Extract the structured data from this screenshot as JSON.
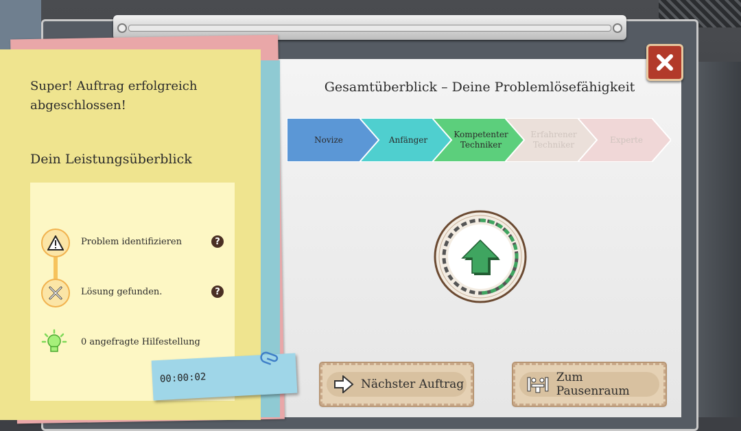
{
  "colors": {
    "novice": "#5b97d6",
    "beginner": "#4fcfcf",
    "competent": "#5ccf7c",
    "faded": "#ebe0da",
    "medal_arrow": "#3fa560",
    "close_button": "#b23a2a"
  },
  "left_panel": {
    "message": "Super! Auftrag erfolgreich abgeschlossen!",
    "performance_title": "Dein Leistungsüberblick",
    "rows": [
      {
        "icon": "warning-icon",
        "label": "Problem identifizieren",
        "help": "?"
      },
      {
        "icon": "tools-icon",
        "label": "Lösung gefunden.",
        "help": "?"
      },
      {
        "icon": "lightbulb-icon",
        "label": "0 angefragte Hilfestellung"
      }
    ],
    "timer": "00:00:02"
  },
  "main": {
    "title": "Gesamtüberblick – Deine Problemlösefähigkeit",
    "levels": [
      {
        "label": "Novize",
        "state": "active"
      },
      {
        "label": "Anfänger",
        "state": "active"
      },
      {
        "label": "Kompetenter Techniker",
        "state": "active"
      },
      {
        "label": "Erfahrener Techniker",
        "state": "inactive"
      },
      {
        "label": "Experte",
        "state": "inactive"
      }
    ],
    "medal_icon": "up-arrow-icon",
    "buttons": {
      "next_label": "Nächster Auftrag",
      "break_label": "Zum Pausenraum"
    }
  }
}
